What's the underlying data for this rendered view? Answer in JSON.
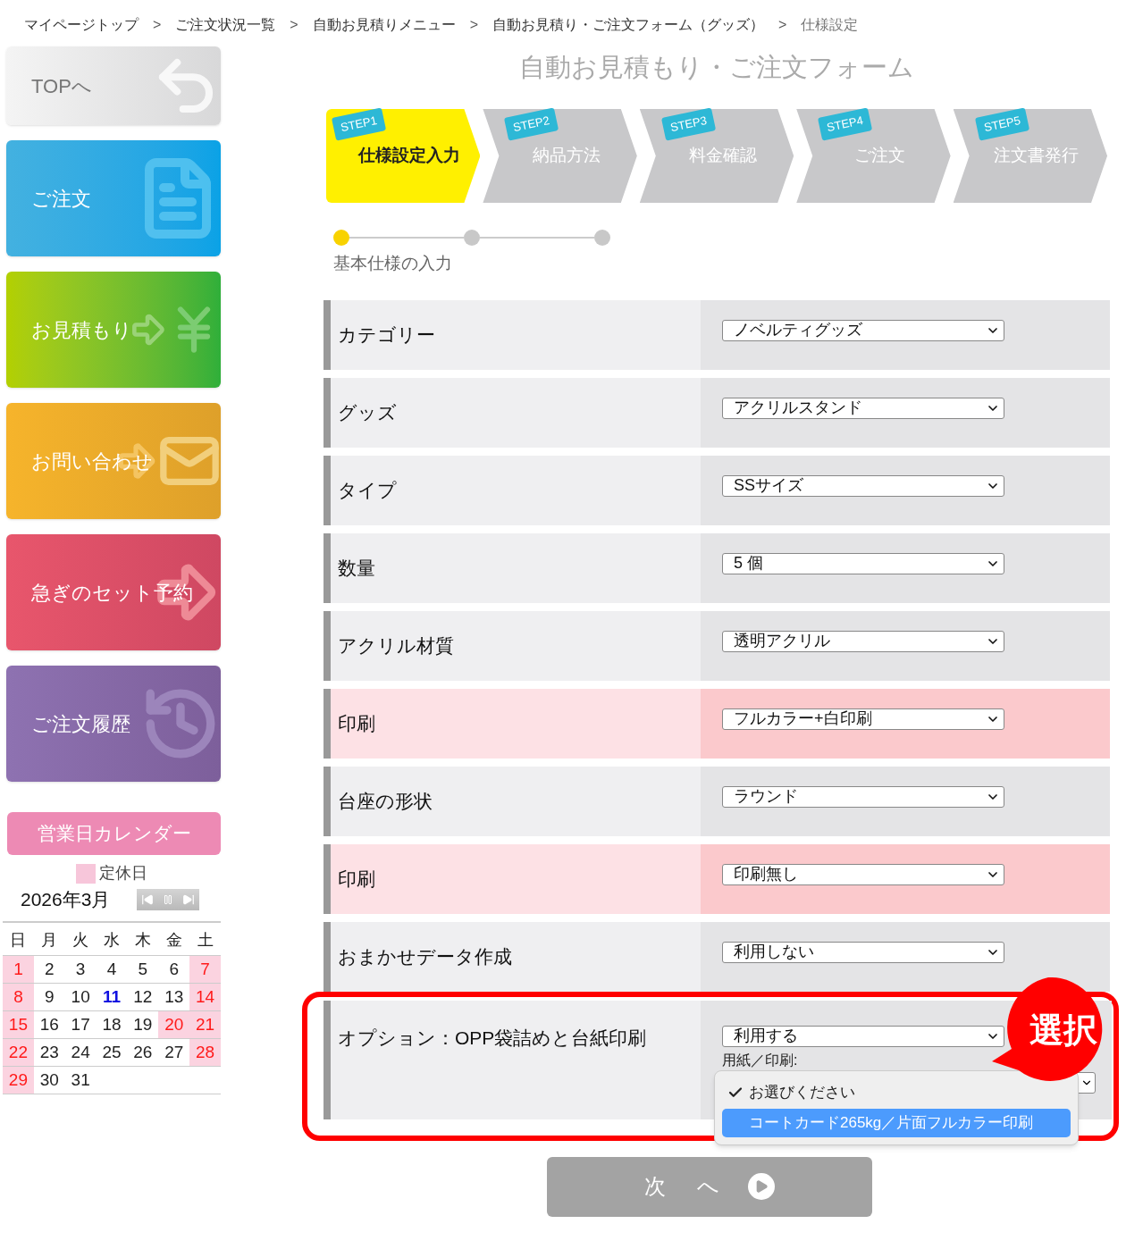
{
  "breadcrumb": [
    {
      "label": "マイページトップ",
      "current": false
    },
    {
      "label": "ご注文状況一覧",
      "current": false
    },
    {
      "label": "自動お見積りメニュー",
      "current": false
    },
    {
      "label": "自動お見積り・ご注文フォーム（グッズ）",
      "current": false
    },
    {
      "label": "仕様設定",
      "current": true
    }
  ],
  "breadcrumb_separator": ">",
  "sidebar": {
    "nav": [
      {
        "label": "TOPへ",
        "kind": "top"
      },
      {
        "label": "ご注文",
        "kind": "order"
      },
      {
        "label": "お見積もり",
        "kind": "estimate"
      },
      {
        "label": "お問い合わせ",
        "kind": "contact"
      },
      {
        "label": "急ぎのセット予約",
        "kind": "rush"
      },
      {
        "label": "ご注文履歴",
        "kind": "history"
      }
    ],
    "calendar": {
      "title": "営業日カレンダー",
      "legend": "定休日",
      "month": "2026年3月",
      "weekdays": [
        "日",
        "月",
        "火",
        "水",
        "木",
        "金",
        "土"
      ],
      "weeks": [
        [
          {
            "day": "1",
            "kind": "holiday"
          },
          {
            "day": "2",
            "kind": "normal"
          },
          {
            "day": "3",
            "kind": "normal"
          },
          {
            "day": "4",
            "kind": "normal"
          },
          {
            "day": "5",
            "kind": "normal"
          },
          {
            "day": "6",
            "kind": "normal"
          },
          {
            "day": "7",
            "kind": "holiday"
          }
        ],
        [
          {
            "day": "8",
            "kind": "holiday"
          },
          {
            "day": "9",
            "kind": "normal"
          },
          {
            "day": "10",
            "kind": "normal"
          },
          {
            "day": "11",
            "kind": "today"
          },
          {
            "day": "12",
            "kind": "normal"
          },
          {
            "day": "13",
            "kind": "normal"
          },
          {
            "day": "14",
            "kind": "holiday"
          }
        ],
        [
          {
            "day": "15",
            "kind": "holiday"
          },
          {
            "day": "16",
            "kind": "normal"
          },
          {
            "day": "17",
            "kind": "normal"
          },
          {
            "day": "18",
            "kind": "normal"
          },
          {
            "day": "19",
            "kind": "normal"
          },
          {
            "day": "20",
            "kind": "holiday"
          },
          {
            "day": "21",
            "kind": "holiday"
          }
        ],
        [
          {
            "day": "22",
            "kind": "holiday"
          },
          {
            "day": "23",
            "kind": "normal"
          },
          {
            "day": "24",
            "kind": "normal"
          },
          {
            "day": "25",
            "kind": "normal"
          },
          {
            "day": "26",
            "kind": "normal"
          },
          {
            "day": "27",
            "kind": "normal"
          },
          {
            "day": "28",
            "kind": "holiday"
          }
        ],
        [
          {
            "day": "29",
            "kind": "holiday"
          },
          {
            "day": "30",
            "kind": "normal"
          },
          {
            "day": "31",
            "kind": "normal"
          }
        ]
      ]
    }
  },
  "form": {
    "title": "自動お見積もり・ご注文フォーム",
    "steps": [
      {
        "badge": "STEP1",
        "label": "仕様設定入力",
        "selected": true
      },
      {
        "badge": "STEP2",
        "label": "納品方法",
        "selected": false
      },
      {
        "badge": "STEP3",
        "label": "料金確認",
        "selected": false
      },
      {
        "badge": "STEP4",
        "label": "ご注文",
        "selected": false
      },
      {
        "badge": "STEP5",
        "label": "注文書発行",
        "selected": false
      }
    ],
    "progress": {
      "dots": [
        {
          "selected": true
        },
        {
          "selected": false
        },
        {
          "selected": false
        }
      ],
      "label": "基本仕様の入力"
    },
    "rows": [
      {
        "label": "カテゴリー",
        "value": "ノベルティグッズ",
        "highlighted": false
      },
      {
        "label": "グッズ",
        "value": "アクリルスタンド",
        "highlighted": false
      },
      {
        "label": "タイプ",
        "value": "SSサイズ",
        "highlighted": false
      },
      {
        "label": "数量",
        "value": "5 個",
        "highlighted": false
      },
      {
        "label": "アクリル材質",
        "value": "透明アクリル",
        "highlighted": false
      },
      {
        "label": "印刷",
        "value": "フルカラー+白印刷",
        "highlighted": true
      },
      {
        "label": "台座の形状",
        "value": "ラウンド",
        "highlighted": false
      },
      {
        "label": "印刷",
        "value": "印刷無し",
        "highlighted": true
      },
      {
        "label": "おまかせデータ作成",
        "value": "利用しない",
        "highlighted": false
      }
    ],
    "option": {
      "label": "オプション：OPP袋詰めと台紙印刷",
      "value": "利用する",
      "sub_label": "用紙／印刷:",
      "callout": "選択",
      "menu": [
        {
          "label": "お選びください",
          "checked": true,
          "selected": false
        },
        {
          "label": "コートカード265kg／片面フルカラー印刷",
          "checked": false,
          "selected": true
        }
      ]
    },
    "next_button": "次 へ"
  }
}
